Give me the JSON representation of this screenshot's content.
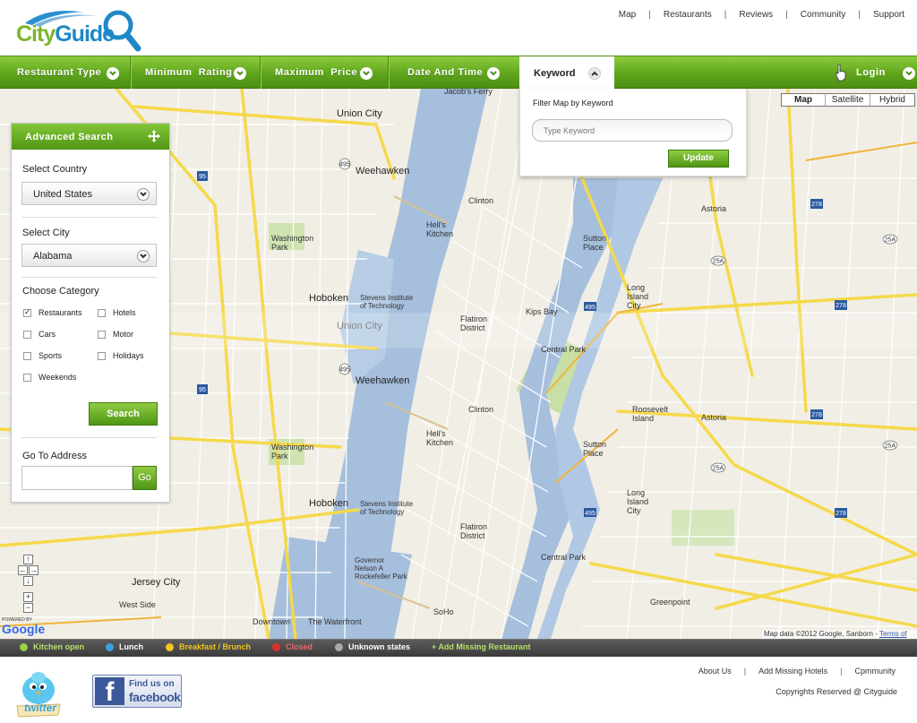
{
  "logo": {
    "part1": "City",
    "part2": "Guide"
  },
  "toplinks": [
    "Map",
    "Restaurants",
    "Reviews",
    "Community",
    "Support"
  ],
  "nav": {
    "items": [
      "Restaurant Type",
      "Minimum  Rating",
      "Maximum  Price",
      "Date And Time"
    ],
    "keyword": "Keyword",
    "login": "Login"
  },
  "maptype": [
    "Map",
    "Satellite",
    "Hybrid"
  ],
  "keyword_panel": {
    "title": "Filter Map by Keyword",
    "placeholder": "Type Keyword",
    "button": "Update"
  },
  "advanced": {
    "title": "Advanced Search",
    "country_label": "Select Country",
    "country_value": "United States",
    "city_label": "Select City",
    "city_value": "Alabama",
    "category_label": "Choose Category",
    "categories": [
      {
        "label": "Restaurants",
        "checked": true
      },
      {
        "label": "Hotels",
        "checked": false
      },
      {
        "label": "Cars",
        "checked": false
      },
      {
        "label": "Motor",
        "checked": false
      },
      {
        "label": "Sports",
        "checked": false
      },
      {
        "label": "Holidays",
        "checked": false
      },
      {
        "label": "Weekends",
        "checked": false
      }
    ],
    "search_button": "Search",
    "address_label": "Go To Address",
    "go_button": "Go"
  },
  "map_labels": [
    "Union City",
    "Weehawken",
    "Hoboken",
    "Jersey City",
    "Clinton",
    "Hell's Kitchen",
    "Sutton Place",
    "Astoria",
    "Long Island City",
    "Kips Bay",
    "Central Park",
    "Roosevelt Island",
    "Washington Park",
    "Flatiron District",
    "Greenpoint",
    "Union City",
    "Weehawken",
    "Hoboken",
    "Clinton",
    "Hell's Kitchen",
    "Sutton Place",
    "Astoria",
    "Long Island City",
    "Central Park",
    "Jacob's Ferry",
    "Stevens Institute of Technology",
    "Stevens Institute of Technology",
    "Washington Park",
    "Flatiron District",
    "SoHo",
    "Downtown",
    "The Waterfront",
    "West Side",
    "Governor Nelson A Rockefeller Park",
    "Sutton Place",
    "Roosevelt Island"
  ],
  "map_footer": {
    "data": "Map data ©2012 Google, Sanborn - ",
    "terms": "Terms of Use",
    "powered": "POWERED BY",
    "google": "Google"
  },
  "legend": [
    {
      "label": "Kitchen open",
      "color": "#9bd040",
      "text_color": "#b7e06a"
    },
    {
      "label": "Lunch",
      "color": "#3aa0e0",
      "text_color": "#ffffff"
    },
    {
      "label": "Breakfast / Brunch",
      "color": "#f3c51b",
      "text_color": "#f3c51b"
    },
    {
      "label": "Closed",
      "color": "#e0302a",
      "text_color": "#ef6b6b"
    },
    {
      "label": "Unknown states",
      "color": "#aaaaaa",
      "text_color": "#ffffff"
    }
  ],
  "add_missing": "+ Add Missing Restaurant",
  "footer": {
    "twitter": "twitter",
    "fb_top": "Find us on",
    "fb_bottom": "facebook",
    "links": [
      "About Us",
      "Add Missing Hotels",
      "Cpmmunity"
    ],
    "copyright": "Copyrights Reserved @ Cityguide"
  },
  "colors": {
    "accent": "#5fa51c",
    "water": "#a5bfdd",
    "road": "#f5d94b"
  }
}
